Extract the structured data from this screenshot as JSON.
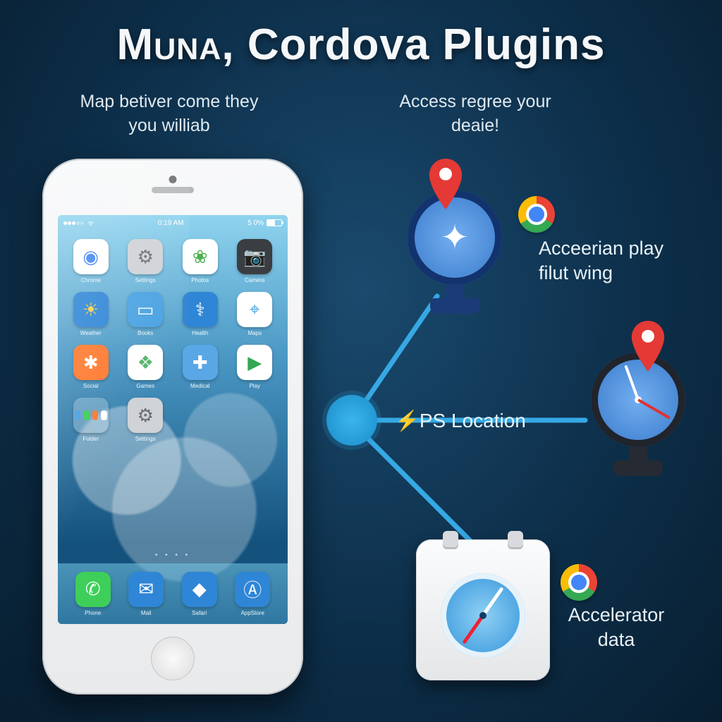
{
  "title": {
    "part1": "Muna,",
    "part2": "Cordova Plugins"
  },
  "subtitle_left": "Map betiver come they you williab",
  "subtitle_right": "Access regree your deaie!",
  "features": {
    "top": "Acceerian play filut wing",
    "center": "⚡PS Location",
    "bottom": "Accelerator data"
  },
  "phone": {
    "status": {
      "carrier_dots": 5,
      "time": "0:19 AM",
      "battery_label": "5 0%"
    },
    "apps_row1": [
      {
        "label": "Chrome",
        "bg": "#fff",
        "glyph": "◉",
        "fg": "#4285f4"
      },
      {
        "label": "Settings",
        "bg": "#cfd2d6",
        "glyph": "⚙",
        "fg": "#6a6d71"
      },
      {
        "label": "Photos",
        "bg": "#fff",
        "glyph": "❀",
        "fg": "#4caf50"
      },
      {
        "label": "Camera",
        "bg": "#3a3d41",
        "glyph": "📷",
        "fg": "#c9cbce"
      }
    ],
    "apps_row2": [
      {
        "label": "Weather",
        "bg": "#2f86d6",
        "glyph": "☀",
        "fg": "#ffd54a"
      },
      {
        "label": "Books",
        "bg": "#4aa3e2",
        "glyph": "▭",
        "fg": "#fff"
      },
      {
        "label": "Health",
        "bg": "#2f86d6",
        "glyph": "⚕",
        "fg": "#fff"
      },
      {
        "label": "Maps",
        "bg": "#fff",
        "glyph": "⌖",
        "fg": "#4aa3e2"
      }
    ],
    "apps_row3": [
      {
        "label": "Social",
        "bg": "#ff7a2f",
        "glyph": "✱",
        "fg": "#fff"
      },
      {
        "label": "Games",
        "bg": "#fff",
        "glyph": "❖",
        "fg": "#53b66b"
      },
      {
        "label": "Medical",
        "bg": "#5aa7e6",
        "glyph": "✚",
        "fg": "#fff"
      },
      {
        "label": "Play",
        "bg": "#fff",
        "glyph": "▶",
        "fg": "#34a853"
      }
    ],
    "apps_row4": [
      {
        "label": "Folder",
        "folder": true
      },
      {
        "label": "Settings",
        "bg": "#cfd2d6",
        "glyph": "⚙",
        "fg": "#6a6d71"
      }
    ],
    "dock": [
      {
        "label": "Phone",
        "bg": "#3ecf5a",
        "glyph": "✆",
        "fg": "#fff"
      },
      {
        "label": "Mail",
        "bg": "#2f86d6",
        "glyph": "✉",
        "fg": "#fff"
      },
      {
        "label": "Safari",
        "bg": "#2f86d6",
        "glyph": "◆",
        "fg": "#fff"
      },
      {
        "label": "AppStore",
        "bg": "#2f86d6",
        "glyph": "Ⓐ",
        "fg": "#fff"
      }
    ],
    "pager": "• • • •"
  },
  "icons": {
    "pin": "map-pin-icon",
    "chrome": "chrome-icon",
    "compass": "compass-icon",
    "calendar_compass": "calendar-compass-icon"
  }
}
